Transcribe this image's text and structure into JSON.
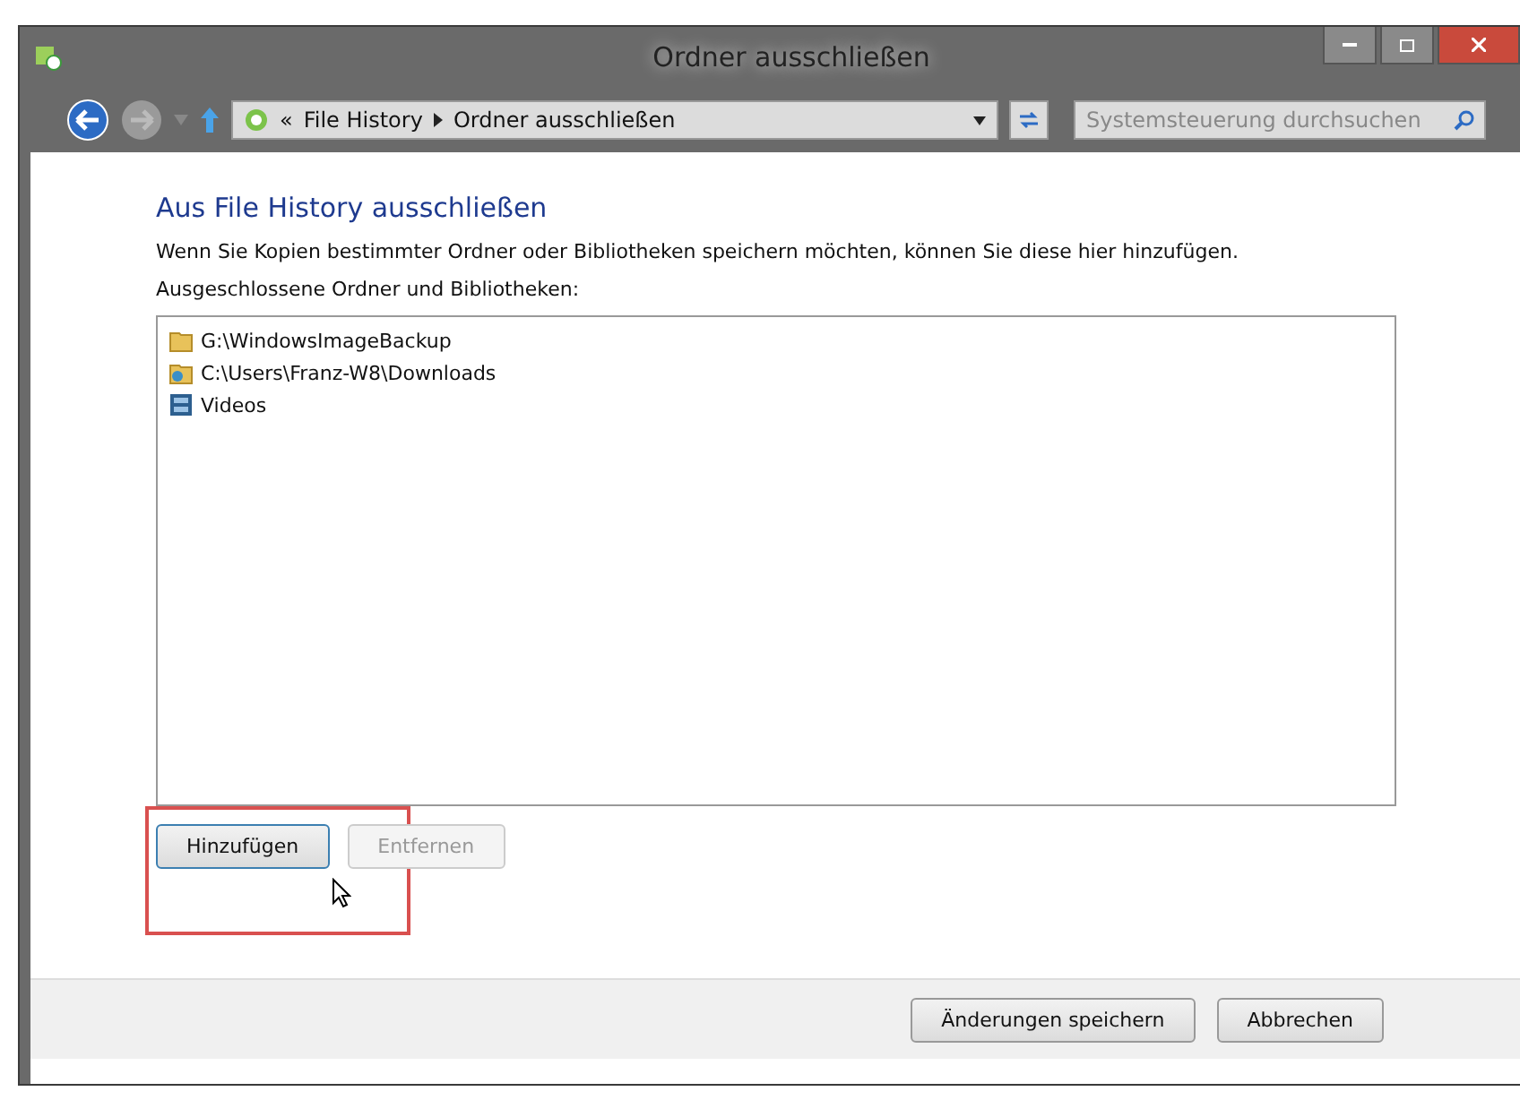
{
  "window": {
    "title": "Ordner ausschließen"
  },
  "address_bar": {
    "overflow": "«",
    "path": [
      "File History",
      "Ordner ausschließen"
    ]
  },
  "search": {
    "placeholder": "Systemsteuerung durchsuchen"
  },
  "heading": "Aus File History ausschließen",
  "description": "Wenn Sie Kopien bestimmter Ordner oder Bibliotheken speichern möchten, können Sie diese hier hinzufügen.",
  "list_label": "Ausgeschlossene Ordner und Bibliotheken:",
  "items": [
    {
      "kind": "folder",
      "label": "G:\\WindowsImageBackup"
    },
    {
      "kind": "user-folder",
      "label": "C:\\Users\\Franz-W8\\Downloads"
    },
    {
      "kind": "library",
      "label": "Videos"
    }
  ],
  "list_buttons": [
    {
      "label": "Hinzufügen",
      "disabled": false,
      "highlighted": true
    },
    {
      "label": "Entfernen",
      "disabled": true,
      "highlighted": false
    }
  ],
  "footer_buttons": [
    {
      "label": "Änderungen speichern"
    },
    {
      "label": "Abbrechen"
    }
  ]
}
